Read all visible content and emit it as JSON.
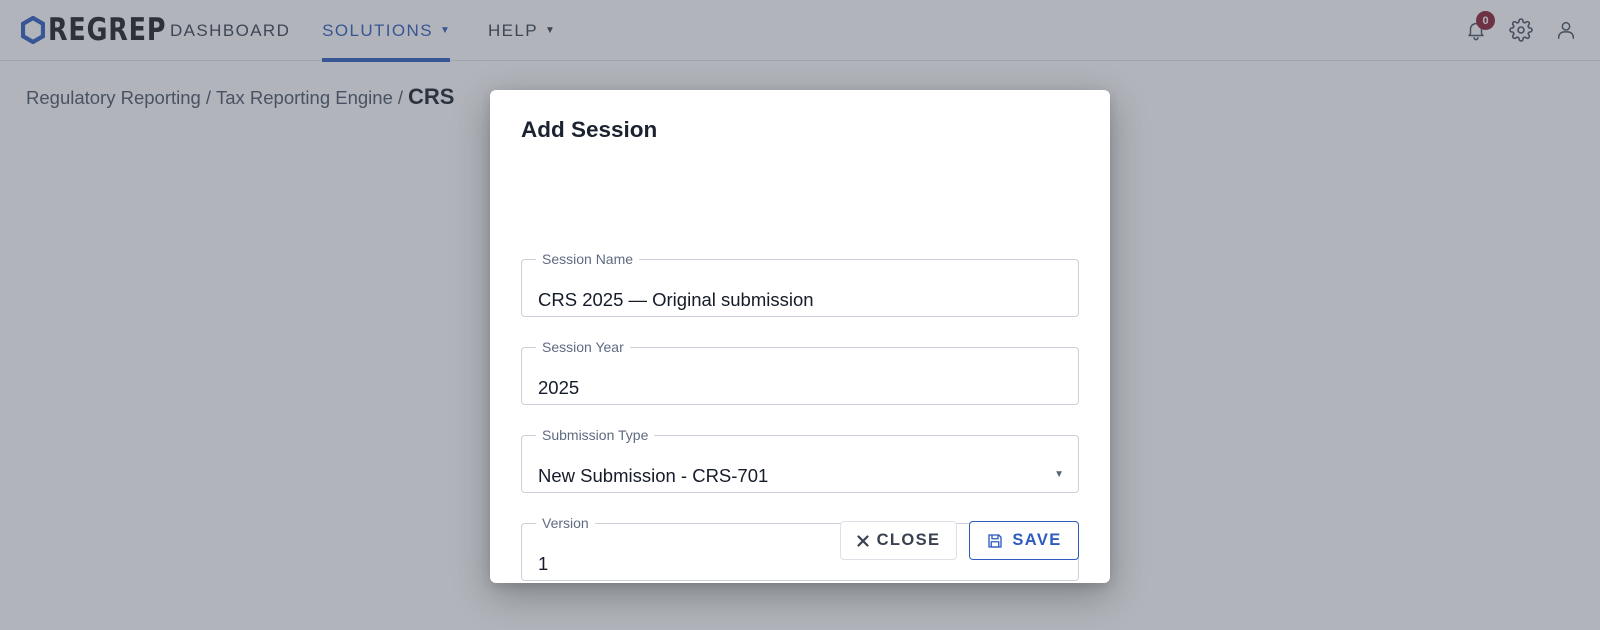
{
  "app": {
    "logo_text": "REGREP"
  },
  "nav": {
    "items": [
      {
        "label": "DASHBOARD"
      },
      {
        "label": "SOLUTIONS",
        "active": true
      },
      {
        "label": "HELP"
      }
    ]
  },
  "header_icons": {
    "notifications_icon": "bell-icon",
    "notifications_count": "0",
    "settings_icon": "gear-icon",
    "account_icon": "user-icon"
  },
  "breadcrumb": {
    "items": [
      "Regulatory Reporting",
      "Tax Reporting Engine"
    ],
    "separator": "/",
    "current": "CRS"
  },
  "dialog": {
    "title": "Add Session",
    "fields": {
      "session_name": {
        "label": "Session Name",
        "value": "CRS 2025 — Original submission"
      },
      "session_year": {
        "label": "Session Year",
        "value": "2025"
      },
      "submission_type": {
        "label": "Submission Type",
        "value": "New Submission - CRS-701"
      },
      "version": {
        "label": "Version",
        "value": "1"
      }
    },
    "buttons": {
      "close_label": "CLOSE",
      "close_icon": "close-icon",
      "save_label": "SAVE",
      "save_icon": "floppy-disk-icon"
    }
  },
  "colors": {
    "accent": "#2f5bbf",
    "badge": "#8c1e35",
    "overlay": "rgba(70,78,92,0.42)",
    "text_primary": "#1b2230",
    "text_secondary": "#5f6b80"
  }
}
